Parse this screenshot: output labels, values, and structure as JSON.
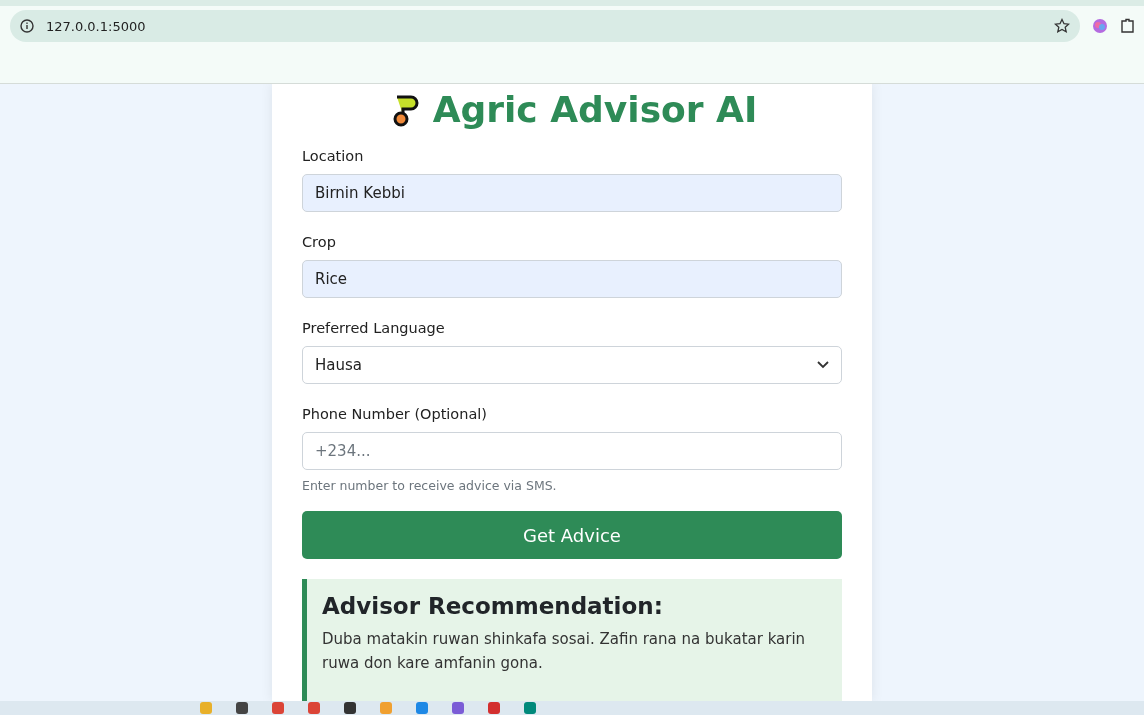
{
  "browser": {
    "url": "127.0.0.1:5000"
  },
  "title": "Agric Advisor AI",
  "fields": [
    {
      "kind": "text",
      "label": "Location",
      "value": "Birnin Kebbi",
      "autofilled": true
    },
    {
      "kind": "text",
      "label": "Crop",
      "value": "Rice",
      "autofilled": true
    },
    {
      "kind": "select",
      "label": "Preferred Language",
      "value": "Hausa",
      "autofilled": false
    },
    {
      "kind": "text",
      "label": "Phone Number (Optional)",
      "placeholder": "+234...",
      "help": "Enter number to receive advice via SMS.",
      "autofilled": false
    }
  ],
  "submit": "Get Advice",
  "recommendation": {
    "heading": "Advisor Recommendation:",
    "text": "Duba matakin ruwan shinkafa sosai. Zafin rana na bukatar karin ruwa don kare amfanin gona."
  }
}
